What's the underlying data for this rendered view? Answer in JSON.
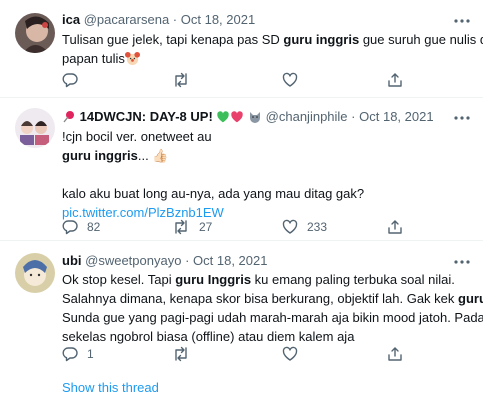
{
  "tweets": [
    {
      "name": "ica",
      "handle": "@pacararsena",
      "dot": "·",
      "date": "Oct 18, 2021",
      "body": [
        [
          {
            "t": "Tulisan gue jelek, tapi kenapa pas SD "
          },
          {
            "t": "guru inggris",
            "bold": true
          },
          {
            "t": " gue suruh gue nulis di"
          }
        ],
        [
          {
            "t": "papan tulis"
          }
        ]
      ],
      "emoji_after": "clown-face",
      "actions": {
        "reply": "",
        "retweet": "",
        "like": ""
      }
    },
    {
      "name": "14DWCJN: DAY-8 UP!",
      "handle": "@chanjinphile",
      "dot": "·",
      "date": "Oct 18, 2021",
      "name_icons": [
        "pushpin-icon",
        "green-heart-icon",
        "pink-heart-icon",
        "wolf-icon"
      ],
      "body": [
        [
          {
            "t": "!cjn bocil ver. onetweet au"
          }
        ],
        [
          {
            "t": "guru inggris",
            "bold": true
          },
          {
            "t": "... 👍🏻"
          }
        ],
        [
          {
            "t": ""
          }
        ],
        [
          {
            "t": "kalo aku buat long au-nya, ada yang mau ditag gak?"
          }
        ],
        [
          {
            "t": "pic.twitter.com/PlzBznb1EW",
            "link": true
          }
        ]
      ],
      "actions": {
        "reply": "82",
        "retweet": "27",
        "like": "233"
      }
    },
    {
      "name": "ubi",
      "handle": "@sweetponyayo",
      "dot": "·",
      "date": "Oct 18, 2021",
      "body": [
        [
          {
            "t": "Ok stop kesel. Tapi "
          },
          {
            "t": "guru Inggris",
            "bold": true
          },
          {
            "t": " ku emang paling terbuka soal nilai."
          }
        ],
        [
          {
            "t": "Salahnya dimana, kenapa skor bisa berkurang, objektif lah. Gak kek "
          },
          {
            "t": "guru",
            "bold": true
          }
        ],
        [
          {
            "t": "Sunda gue yang pagi-pagi udah marah-marah aja bikin mood jatoh. Padahal"
          }
        ],
        [
          {
            "t": "sekelas ngobrol biasa (offline) atau diem kalem aja"
          }
        ]
      ],
      "actions": {
        "reply": "1",
        "retweet": "",
        "like": ""
      }
    }
  ],
  "show_thread": "Show this thread",
  "colors": {
    "text": "#0f1419",
    "muted": "#536471",
    "link": "#1d9bf0",
    "divider": "#eff3f4"
  }
}
